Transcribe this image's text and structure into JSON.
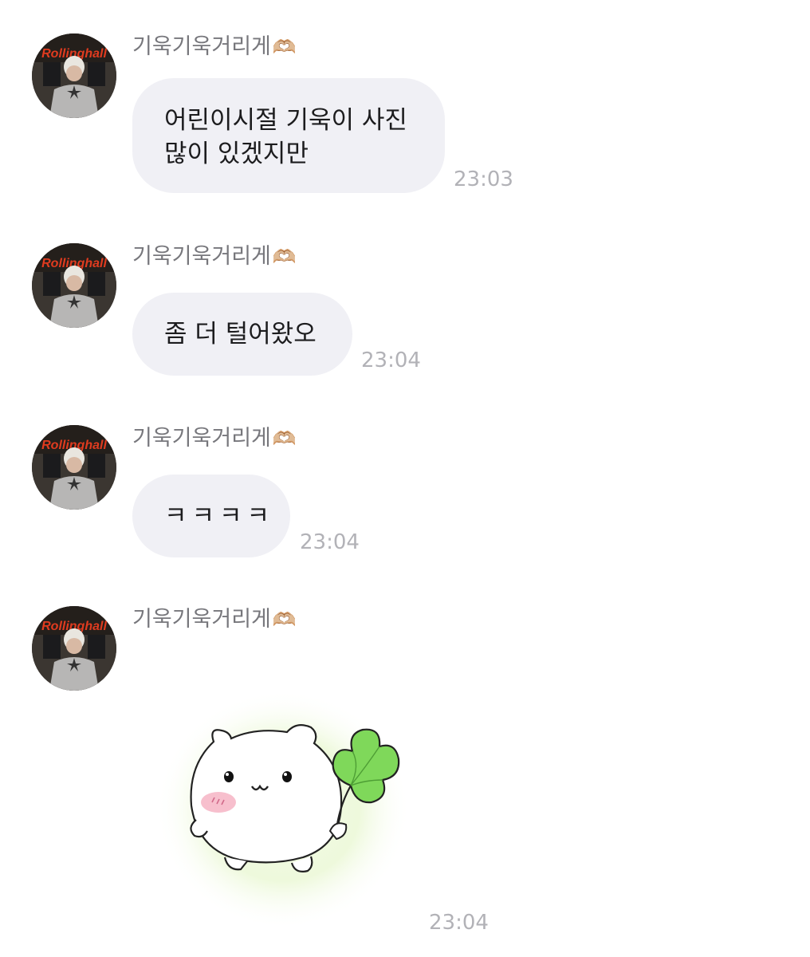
{
  "messages": [
    {
      "sender": "기욱기욱거리게",
      "sender_emoji": "🫶🏼",
      "lines": [
        "어린이시절 기욱이 사진",
        "많이 있겠지만"
      ],
      "time": "23:03"
    },
    {
      "sender": "기욱기욱거리게",
      "sender_emoji": "🫶🏼",
      "lines": [
        "좀 더 털어왔오"
      ],
      "time": "23:04"
    },
    {
      "sender": "기욱기욱거리게",
      "sender_emoji": "🫶🏼",
      "lines": [
        "ㅋㅋㅋㅋ"
      ],
      "time": "23:04"
    },
    {
      "sender": "기욱기욱거리게",
      "sender_emoji": "🫶🏼",
      "sticker": "hamster-holding-clover-sticker",
      "time": "23:04"
    }
  ],
  "avatar": {
    "banner_text": "Rollinghall",
    "banner_color": "#e03b1f"
  },
  "colors": {
    "bubble": "#f0f0f5",
    "sender": "#77777c",
    "time": "#b2b2b7",
    "clover": "#7fd85a"
  }
}
